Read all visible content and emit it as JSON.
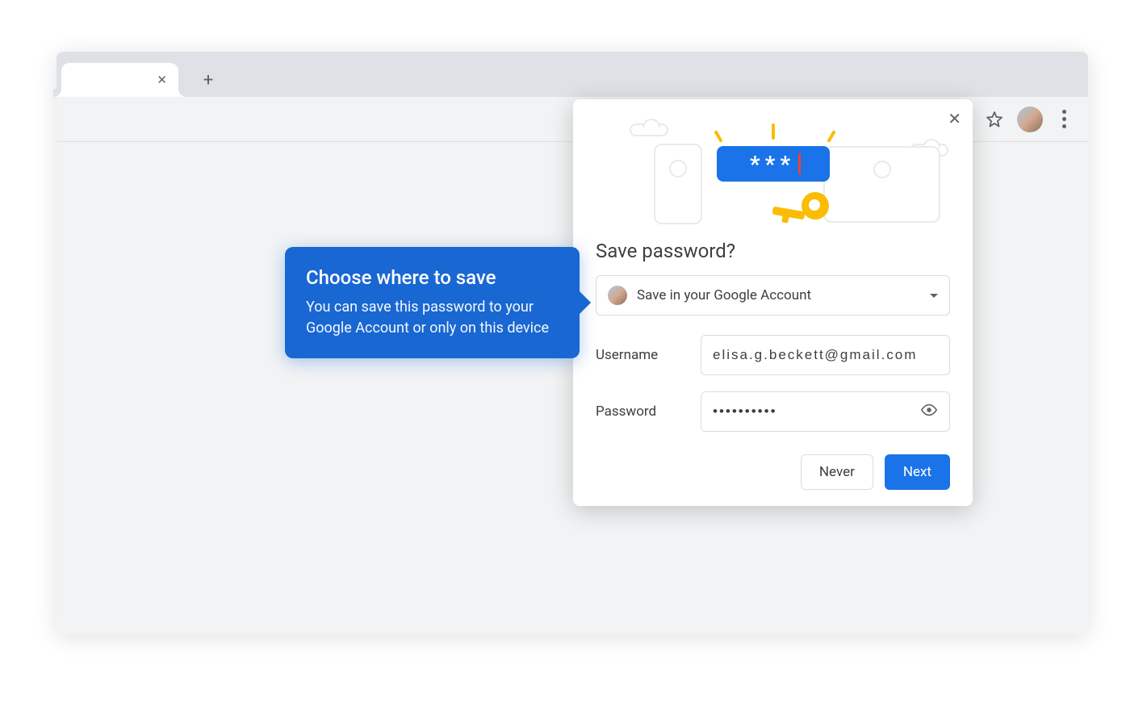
{
  "popup": {
    "title": "Save password?",
    "account_selector_label": "Save in your Google Account",
    "username_label": "Username",
    "username_value": "elisa.g.beckett@gmail.com",
    "password_label": "Password",
    "password_value": "••••••••••",
    "btn_never": "Never",
    "btn_next": "Next",
    "illustration_field_text": "***"
  },
  "callout": {
    "title": "Choose where to save",
    "body": "You can save this password to your Google Account or only on this device"
  }
}
